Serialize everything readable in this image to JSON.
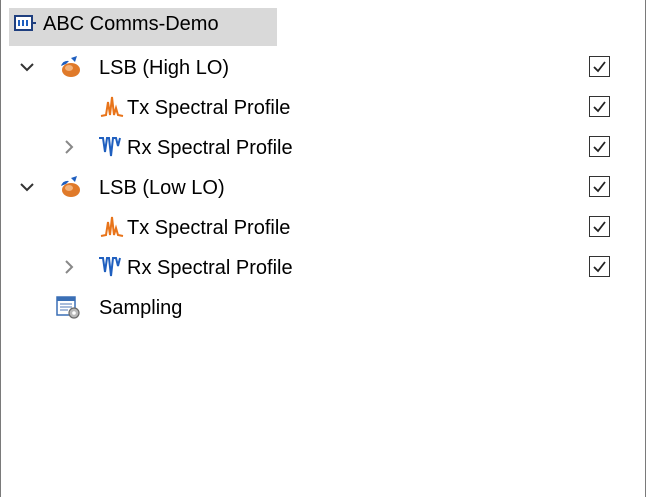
{
  "tree": {
    "root": {
      "label": "ABC Comms-Demo",
      "icon": "module-icon",
      "selected": true
    },
    "items": [
      {
        "label": "LSB (High LO)",
        "icon": "scenario-icon",
        "expander": "expanded",
        "checked": true
      },
      {
        "label": "Tx Spectral Profile",
        "icon": "tx-spectrum-icon",
        "expander": "none",
        "checked": true
      },
      {
        "label": "Rx Spectral Profile",
        "icon": "rx-spectrum-icon",
        "expander": "collapsed",
        "checked": true
      },
      {
        "label": "LSB (Low LO)",
        "icon": "scenario-icon",
        "expander": "expanded",
        "checked": true
      },
      {
        "label": "Tx Spectral Profile",
        "icon": "tx-spectrum-icon",
        "expander": "none",
        "checked": true
      },
      {
        "label": "Rx Spectral Profile",
        "icon": "rx-spectrum-icon",
        "expander": "collapsed",
        "checked": true
      },
      {
        "label": "Sampling",
        "icon": "sampling-settings-icon",
        "expander": "none",
        "checked": null
      }
    ]
  },
  "colors": {
    "selection": "#d9d9d9",
    "accent_blue": "#1f5fbf",
    "tx_orange": "#e8741a",
    "scenario_orange": "#e07a2a"
  }
}
